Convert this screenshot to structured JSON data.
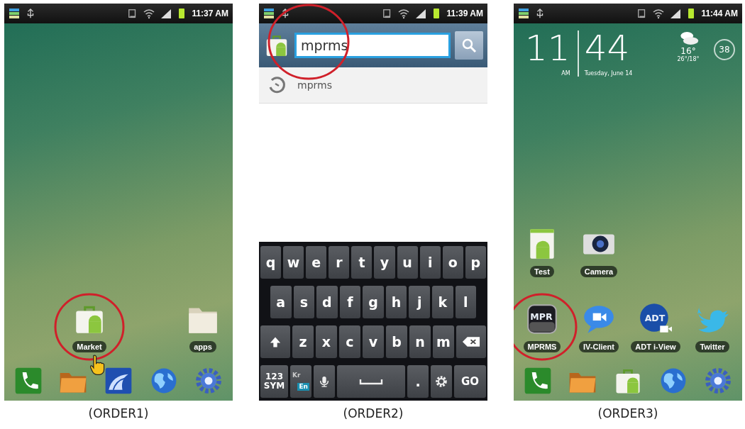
{
  "panels": [
    {
      "kind": "home",
      "caption": "(ORDER1)",
      "status_bar": {
        "time": "11:37 AM"
      },
      "app_rows": [
        [
          {
            "kind": "blank"
          },
          {
            "kind": "market",
            "label": "Market",
            "circled": true,
            "tapped": true
          },
          {
            "kind": "blank"
          },
          {
            "kind": "folder",
            "label": "apps",
            "circled": false,
            "tapped": false
          }
        ]
      ],
      "dock": [
        {
          "kind": "phone"
        },
        {
          "kind": "folder-orange"
        },
        {
          "kind": "cloud"
        },
        {
          "kind": "globe"
        },
        {
          "kind": "gear"
        }
      ]
    },
    {
      "kind": "search",
      "caption": "(ORDER2)",
      "status_bar": {
        "time": "11:39 AM"
      },
      "search": {
        "value": "mprms",
        "circled": true
      },
      "suggestions": [
        {
          "text": "mprms"
        }
      ],
      "keyboard": {
        "rows": [
          {
            "keys": [
              {
                "kind": "letter",
                "label": "q"
              },
              {
                "kind": "letter",
                "label": "w"
              },
              {
                "kind": "letter",
                "label": "e"
              },
              {
                "kind": "letter",
                "label": "r"
              },
              {
                "kind": "letter",
                "label": "t"
              },
              {
                "kind": "letter",
                "label": "y"
              },
              {
                "kind": "letter",
                "label": "u"
              },
              {
                "kind": "letter",
                "label": "i"
              },
              {
                "kind": "letter",
                "label": "o"
              },
              {
                "kind": "letter",
                "label": "p"
              }
            ]
          },
          {
            "keys": [
              {
                "kind": "letter",
                "label": "a"
              },
              {
                "kind": "letter",
                "label": "s"
              },
              {
                "kind": "letter",
                "label": "d"
              },
              {
                "kind": "letter",
                "label": "f"
              },
              {
                "kind": "letter",
                "label": "g"
              },
              {
                "kind": "letter",
                "label": "h"
              },
              {
                "kind": "letter",
                "label": "j"
              },
              {
                "kind": "letter",
                "label": "k"
              },
              {
                "kind": "letter",
                "label": "l"
              }
            ]
          },
          {
            "keys": [
              {
                "kind": "shift"
              },
              {
                "kind": "letter",
                "label": "z"
              },
              {
                "kind": "letter",
                "label": "x"
              },
              {
                "kind": "letter",
                "label": "c"
              },
              {
                "kind": "letter",
                "label": "v"
              },
              {
                "kind": "letter",
                "label": "b"
              },
              {
                "kind": "letter",
                "label": "n"
              },
              {
                "kind": "letter",
                "label": "m"
              },
              {
                "kind": "backspace"
              }
            ]
          },
          {
            "keys": [
              {
                "kind": "symbols",
                "lines": [
                  "123",
                  "SYM"
                ]
              },
              {
                "kind": "language",
                "options": [
                  {
                    "text": "Kr",
                    "selected": false
                  },
                  {
                    "text": "En",
                    "selected": true
                  }
                ]
              },
              {
                "kind": "mic"
              },
              {
                "kind": "space"
              },
              {
                "kind": "letter",
                "label": "."
              },
              {
                "kind": "settings"
              },
              {
                "kind": "action",
                "label": "GO"
              }
            ]
          }
        ]
      }
    },
    {
      "kind": "home",
      "caption": "(ORDER3)",
      "status_bar": {
        "time": "11:44 AM"
      },
      "clock": {
        "hour": "11",
        "minute": "44",
        "ampm": "AM",
        "date": "Tuesday, June 14"
      },
      "weather": {
        "temp": "16°",
        "range": "26°/18°"
      },
      "badge": "38",
      "app_rows": [
        [
          {
            "kind": "test",
            "label": "Test",
            "circled": false,
            "tapped": false
          },
          {
            "kind": "camera",
            "label": "Camera",
            "circled": false,
            "tapped": false
          },
          {
            "kind": "blank"
          },
          {
            "kind": "blank"
          }
        ],
        [
          {
            "kind": "mprms",
            "label": "MPRMS",
            "icon_text": "MPR",
            "circled": true,
            "tapped": false
          },
          {
            "kind": "ivclient",
            "label": "IV-Client",
            "circled": false,
            "tapped": false
          },
          {
            "kind": "adt",
            "label": "ADT i-View",
            "icon_text": "ADT",
            "circled": false,
            "tapped": false
          },
          {
            "kind": "twitter",
            "label": "Twitter",
            "circled": false,
            "tapped": false
          }
        ]
      ],
      "dock": [
        {
          "kind": "phone"
        },
        {
          "kind": "folder-orange"
        },
        {
          "kind": "market"
        },
        {
          "kind": "globe"
        },
        {
          "kind": "gear"
        }
      ]
    }
  ]
}
